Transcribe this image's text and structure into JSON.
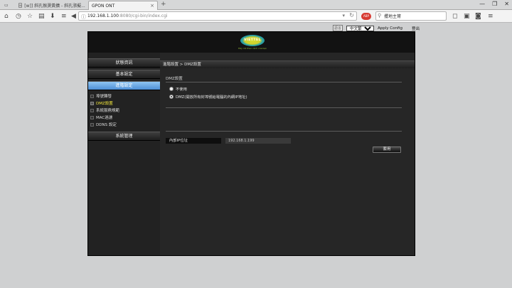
{
  "browser": {
    "tabs": [
      {
        "label": "[w]] 斜孔猴燙黃擴 - 斜孔漲擬...",
        "active": false
      },
      {
        "label": "GPON ONT",
        "active": true
      }
    ],
    "url": {
      "host": "192.168.1.100",
      "path": ":8080/cgi-bin/index.cgi"
    },
    "search_placeholder": "攫地主膂",
    "new_tab": "+",
    "window_controls": [
      "—",
      "❐",
      "✕"
    ]
  },
  "page": {
    "top_links": {
      "language_selected": "中文繁體",
      "apply_config": "Apply Config",
      "logout": "登出"
    },
    "logo": {
      "brand": "VIETTEL",
      "slogan": "Hãy nói theo cách của bạn",
      "colors": {
        "yellow": "#d6dd33",
        "teal": "#1c7f86"
      }
    },
    "sidebar": {
      "sections": [
        {
          "label": "狀態資訊",
          "active": false
        },
        {
          "label": "基本設定",
          "active": false
        },
        {
          "label": "進階設定",
          "active": true
        },
        {
          "label": "系統管理",
          "active": false
        }
      ],
      "sub_items": [
        {
          "label": "埠號轉發",
          "selected": false
        },
        {
          "label": "DMZ設置",
          "selected": true
        },
        {
          "label": "系統服務規範",
          "selected": false
        },
        {
          "label": "MAC過濾",
          "selected": false
        },
        {
          "label": "DDNS 設定",
          "selected": false
        }
      ]
    },
    "content": {
      "breadcrumb": "進階設置 > DMZ設置",
      "section_title": "DMZ設置",
      "options": [
        {
          "label": "不使用",
          "checked": false
        },
        {
          "label": "DMZ(開放所有封埠號給電腦的內網IP地址)",
          "checked": true
        }
      ],
      "ip_label": "內部IP位址",
      "ip_value": "192.168.1.199",
      "apply_label": "套用"
    }
  }
}
